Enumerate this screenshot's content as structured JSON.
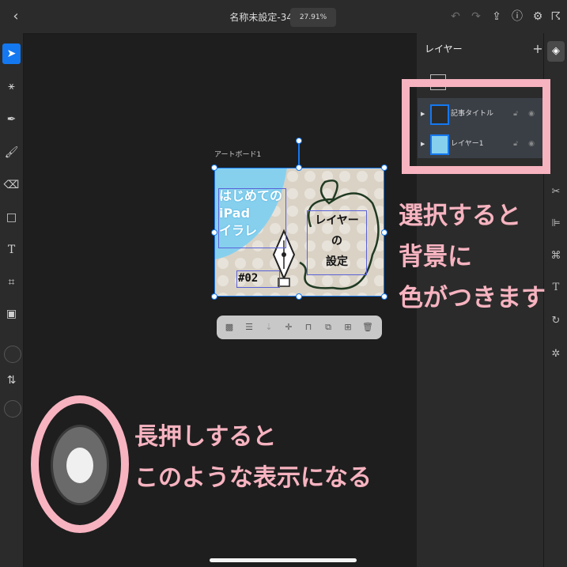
{
  "topbar": {
    "document_title": "名称未設定-34",
    "zoom_level": "27.91%"
  },
  "layers_panel": {
    "title": "レイヤー",
    "layers": [
      {
        "name": "記事タイトル"
      },
      {
        "name": "レイヤー1"
      }
    ]
  },
  "canvas": {
    "artboard_label": "アートボード1",
    "artwork_text": {
      "line1": "はじめての",
      "line2": "iPad",
      "line3": "イラレ",
      "number": "#02",
      "badge1": "レイヤー",
      "badge2": "の",
      "badge3": "設定"
    }
  },
  "annotations": {
    "select_line1": "選択すると",
    "select_line2": "背景に",
    "select_line3": "色がつきます",
    "longpress_line1": "長押しすると",
    "longpress_line2": "このような表示になる"
  },
  "colors": {
    "accent": "#1478f0",
    "annotation_pink": "#f7b3c0",
    "artwork_blue": "#86d0ee",
    "artwork_beige": "#d9d2c5"
  }
}
